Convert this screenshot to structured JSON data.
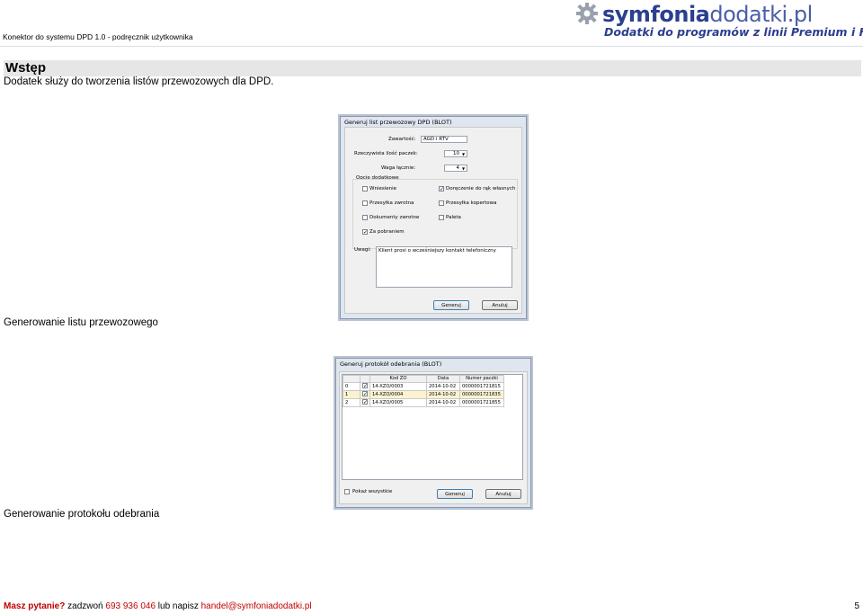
{
  "header": {
    "doc_title": "Konektor do systemu DPD 1.0  - podręcznik użytkownika",
    "logo_main_bold": "symfonia",
    "logo_main_light": "dodatki.pl",
    "logo_tagline": "Dodatki do programów z linii Premium i Forte"
  },
  "section": {
    "title": "Wstęp",
    "intro": "Dodatek służy do tworzenia listów przewozowych dla DPD."
  },
  "dialog1": {
    "title": "Generuj list przewozowy DPD (BLOT)",
    "zawartosc_label": "Zawartość:",
    "zawartosc_value": "AGD i RTV",
    "ilosc_label": "Rzeczywista ilość paczek:",
    "ilosc_value": "10",
    "waga_label": "Waga łącznie:",
    "waga_value": "4",
    "opcje_label": "Opcje dodatkowe",
    "options": [
      {
        "label": "Wniesienie",
        "checked": false
      },
      {
        "label": "Doręczenie do rąk własnych",
        "checked": true
      },
      {
        "label": "Przesyłka zwrotna",
        "checked": false
      },
      {
        "label": "Przesyłka kopertowa",
        "checked": false
      },
      {
        "label": "Dokumenty zwrotne",
        "checked": false
      },
      {
        "label": "Paleta",
        "checked": false
      },
      {
        "label": "Za pobraniem",
        "checked": true
      }
    ],
    "uwagi_label": "Uwagi:",
    "uwagi_value": "Klient prosi o wcześniejszy kontakt telefoniczny",
    "ok_label": "Generuj",
    "cancel_label": "Anuluj",
    "caption": "Generowanie listu przewozowego"
  },
  "dialog2": {
    "title": "Generuj protokół odebrania (BLOT)",
    "columns": [
      "",
      "",
      "Kod ZO",
      "Data",
      "Numer paczki"
    ],
    "rows": [
      {
        "idx": "0",
        "kod": "14-XZO/0003",
        "data": "2014-10-02",
        "numer": "0000001721815"
      },
      {
        "idx": "1",
        "kod": "14-XZO/0004",
        "data": "2014-10-02",
        "numer": "0000001721835"
      },
      {
        "idx": "2",
        "kod": "14-XZO/0005",
        "data": "2014-10-02",
        "numer": "0000001721855"
      }
    ],
    "show_all_label": "Pokaż wszystkie",
    "ok_label": "Generuj",
    "cancel_label": "Anuluj",
    "caption": "Generowanie protokołu odebrania"
  },
  "footer": {
    "question": "Masz pytanie?",
    "call": " zadzwoń ",
    "phone": "693 936 046",
    "or_write": " lub napisz ",
    "email": "handel@symfoniadodatki.pl",
    "page_number": "5"
  },
  "colors": {
    "accent_red": "#c00000",
    "brand_blue": "#2b3f8f"
  }
}
